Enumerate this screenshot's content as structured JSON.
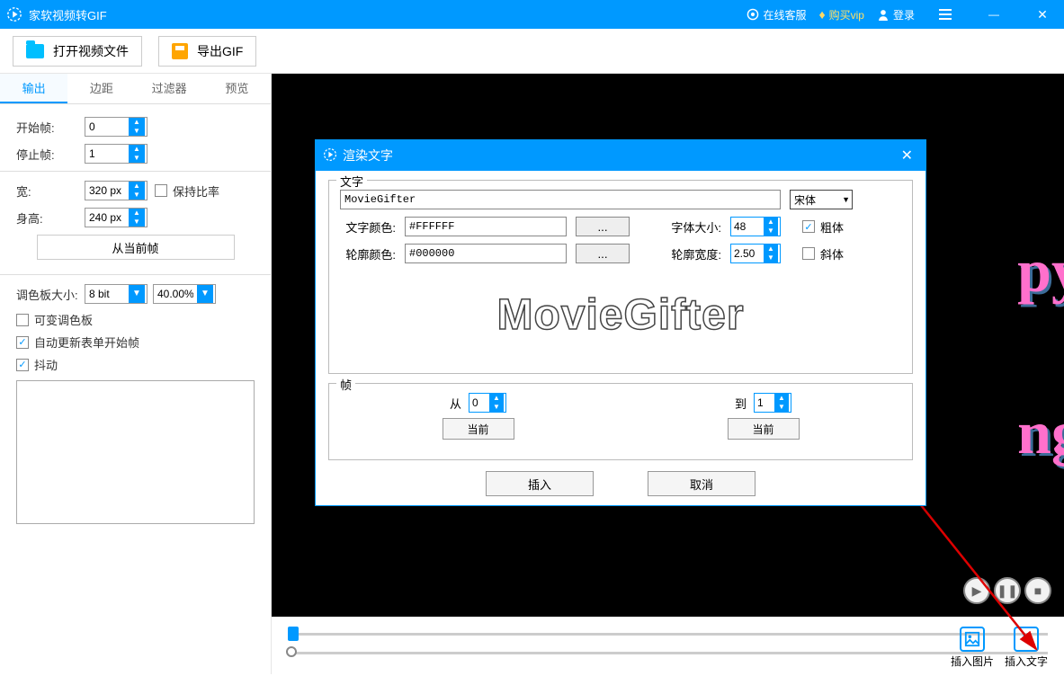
{
  "titlebar": {
    "title": "家软视频转GIF",
    "support": "在线客服",
    "buy": "购买vip",
    "login": "登录"
  },
  "toolbar": {
    "open": "打开视频文件",
    "export": "导出GIF"
  },
  "tabs": [
    "输出",
    "边距",
    "过滤器",
    "预览"
  ],
  "output": {
    "start_label": "开始帧:",
    "start_value": "0",
    "stop_label": "停止帧:",
    "stop_value": "1",
    "width_label": "宽:",
    "width_value": "320 px",
    "height_label": "身高:",
    "height_value": "240 px",
    "keep_ratio": "保持比率",
    "from_current": "从当前帧",
    "palette_label": "调色板大小:",
    "palette_value": "8 bit",
    "palette_pct": "40.00%",
    "chk_variable": "可变调色板",
    "chk_auto": "自动更新表单开始帧",
    "chk_dither": "抖动"
  },
  "dialog": {
    "title": "渲染文字",
    "text_group": "文字",
    "text_value": "MovieGifter",
    "font": "宋体",
    "text_color_label": "文字颜色:",
    "text_color_value": "#FFFFFF",
    "dots": "...",
    "font_size_label": "字体大小:",
    "font_size_value": "48",
    "bold": "粗体",
    "outline_color_label": "轮廓颜色:",
    "outline_color_value": "#000000",
    "outline_width_label": "轮廓宽度:",
    "outline_width_value": "2.50",
    "italic": "斜体",
    "preview_text": "MovieGifter",
    "frame_group": "帧",
    "from_label": "从",
    "from_value": "0",
    "to_label": "到",
    "to_value": "1",
    "current": "当前",
    "insert": "插入",
    "cancel": "取消"
  },
  "bg": {
    "line1": "py",
    "line2": "ng"
  },
  "tools": {
    "insert_image": "插入图片",
    "insert_text": "插入文字"
  }
}
